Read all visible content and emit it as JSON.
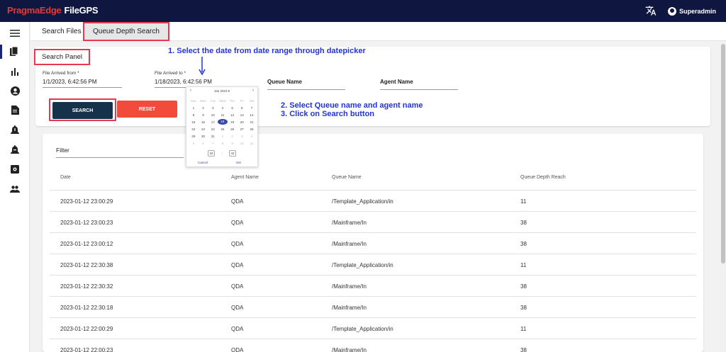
{
  "header": {
    "brand": "PragmaEdge",
    "app": "FileGPS",
    "user": "Superadmin"
  },
  "tabs": [
    {
      "label": "Search Files"
    },
    {
      "label": "Queue Depth Search"
    }
  ],
  "search_panel": {
    "title": "Search Panel",
    "from_label": "File Arrived from *",
    "from_value": "1/1/2023, 6:42:56 PM",
    "to_label": "File Arrived to *",
    "to_value": "1/18/2023, 6:42:56 PM",
    "queue_label": "Queue Name",
    "agent_label": "Agent Name",
    "search_btn": "SEARCH",
    "reset_btn": "RESET"
  },
  "notes": {
    "n1": "1. Select the date from date range through datepicker",
    "n2": "2. Select Queue name and agent name",
    "n3": "3. Click on Search button"
  },
  "datepicker": {
    "month": "Jan 2023 ▾",
    "weekdays": [
      "Sun",
      "Mon",
      "Tue",
      "Wed",
      "Thu",
      "Fri",
      "Sat"
    ],
    "weeks": [
      [
        "1",
        "2",
        "3",
        "4",
        "5",
        "6",
        "7"
      ],
      [
        "8",
        "9",
        "10",
        "11",
        "12",
        "13",
        "14"
      ],
      [
        "15",
        "16",
        "17",
        "18",
        "19",
        "20",
        "21"
      ],
      [
        "22",
        "23",
        "24",
        "25",
        "26",
        "27",
        "28"
      ],
      [
        "29",
        "30",
        "31",
        "1",
        "2",
        "3",
        "4"
      ],
      [
        "5",
        "6",
        "7",
        "8",
        "9",
        "10",
        "11"
      ]
    ],
    "selected": "18",
    "hour": "18",
    "minute": "42",
    "cancel": "Cancel",
    "set": "Set"
  },
  "results": {
    "filter": "Filter",
    "columns": [
      "Date",
      "Agent Name",
      "Queue Name",
      "Queue Depth Reach"
    ],
    "rows": [
      [
        "2023-01-12 23:00:29",
        "QDA",
        "/Template_Application/in",
        "11"
      ],
      [
        "2023-01-12 23:00:23",
        "QDA",
        "/Mainframe/In",
        "38"
      ],
      [
        "2023-01-12 23:00:12",
        "QDA",
        "/Mainframe/In",
        "38"
      ],
      [
        "2023-01-12 22:30:38",
        "QDA",
        "/Template_Application/in",
        "11"
      ],
      [
        "2023-01-12 22:30:32",
        "QDA",
        "/Mainframe/In",
        "38"
      ],
      [
        "2023-01-12 22:30:18",
        "QDA",
        "/Mainframe/In",
        "38"
      ],
      [
        "2023-01-12 22:00:29",
        "QDA",
        "/Template_Application/in",
        "11"
      ],
      [
        "2023-01-12 22:00:23",
        "QDA",
        "/Mainframe/In",
        "38"
      ]
    ]
  },
  "icons": {
    "sidebar": [
      "menu-icon",
      "file-copy-icon",
      "bar-chart-icon",
      "account-icon",
      "document-icon",
      "alert-bell-icon",
      "notification-bell-icon",
      "settings-box-icon",
      "group-icon"
    ]
  }
}
